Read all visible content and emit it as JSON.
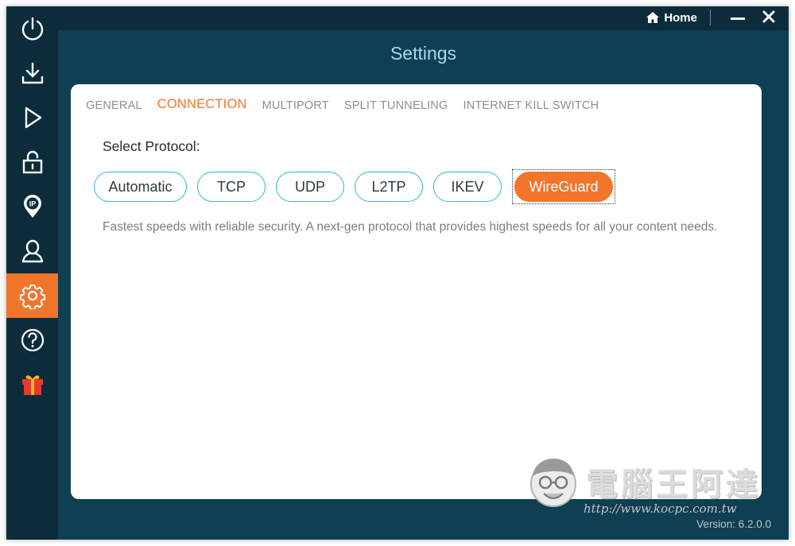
{
  "titlebar": {
    "home_label": "Home"
  },
  "header": {
    "title": "Settings"
  },
  "sidebar": {
    "items": [
      {
        "icon": "power-icon",
        "active": false
      },
      {
        "icon": "download-icon",
        "active": false
      },
      {
        "icon": "play-icon",
        "active": false
      },
      {
        "icon": "lock-icon",
        "active": false
      },
      {
        "icon": "ip-pin-icon",
        "active": false
      },
      {
        "icon": "user-icon",
        "active": false
      },
      {
        "icon": "gear-icon",
        "active": true
      },
      {
        "icon": "help-icon",
        "active": false
      },
      {
        "icon": "gift-icon",
        "active": false
      }
    ]
  },
  "tabs": [
    {
      "label": "GENERAL",
      "active": false
    },
    {
      "label": "CONNECTION",
      "active": true
    },
    {
      "label": "MULTIPORT",
      "active": false
    },
    {
      "label": "SPLIT TUNNELING",
      "active": false
    },
    {
      "label": "INTERNET KILL SWITCH",
      "active": false
    }
  ],
  "connection": {
    "select_label": "Select Protocol:",
    "protocols": [
      "Automatic",
      "TCP",
      "UDP",
      "L2TP",
      "IKEV",
      "WireGuard"
    ],
    "selected_protocol": "WireGuard",
    "description": "Fastest speeds with reliable security. A next-gen protocol that provides highest speeds for all your content needs."
  },
  "footer": {
    "version": "Version: 6.2.0.0"
  },
  "watermark": {
    "text": "電腦王阿達",
    "url": "http://www.kocpc.com.tw"
  },
  "colors": {
    "accent": "#f1752b",
    "outline": "#34b7cc",
    "sidebar": "#0c2c3b",
    "background": "#0f3f53"
  }
}
